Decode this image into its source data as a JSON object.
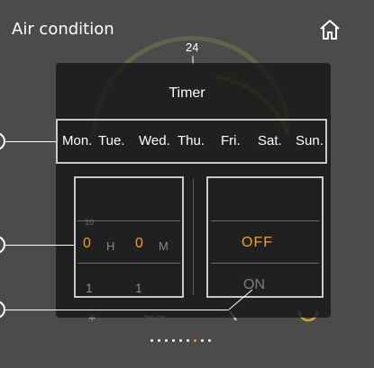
{
  "header": {
    "title": "Air condition",
    "top_label": "24"
  },
  "timer": {
    "title": "Timer",
    "days": [
      "Mon.",
      "Tue.",
      "Wed.",
      "Thu.",
      "Fri.",
      "Sat.",
      "Sun."
    ],
    "hour_value": "0",
    "hour_unit": "H",
    "minute_value": "0",
    "minute_unit": "M",
    "next_hour": "1",
    "next_minute": "1",
    "prev_hour": "10",
    "state_selected": "OFF",
    "state_next": "ON"
  },
  "pager": {
    "count": 8,
    "active_index": 6
  },
  "colors": {
    "accent": "#f0a020",
    "background": "#4b4b4b",
    "panel": "#141414"
  }
}
